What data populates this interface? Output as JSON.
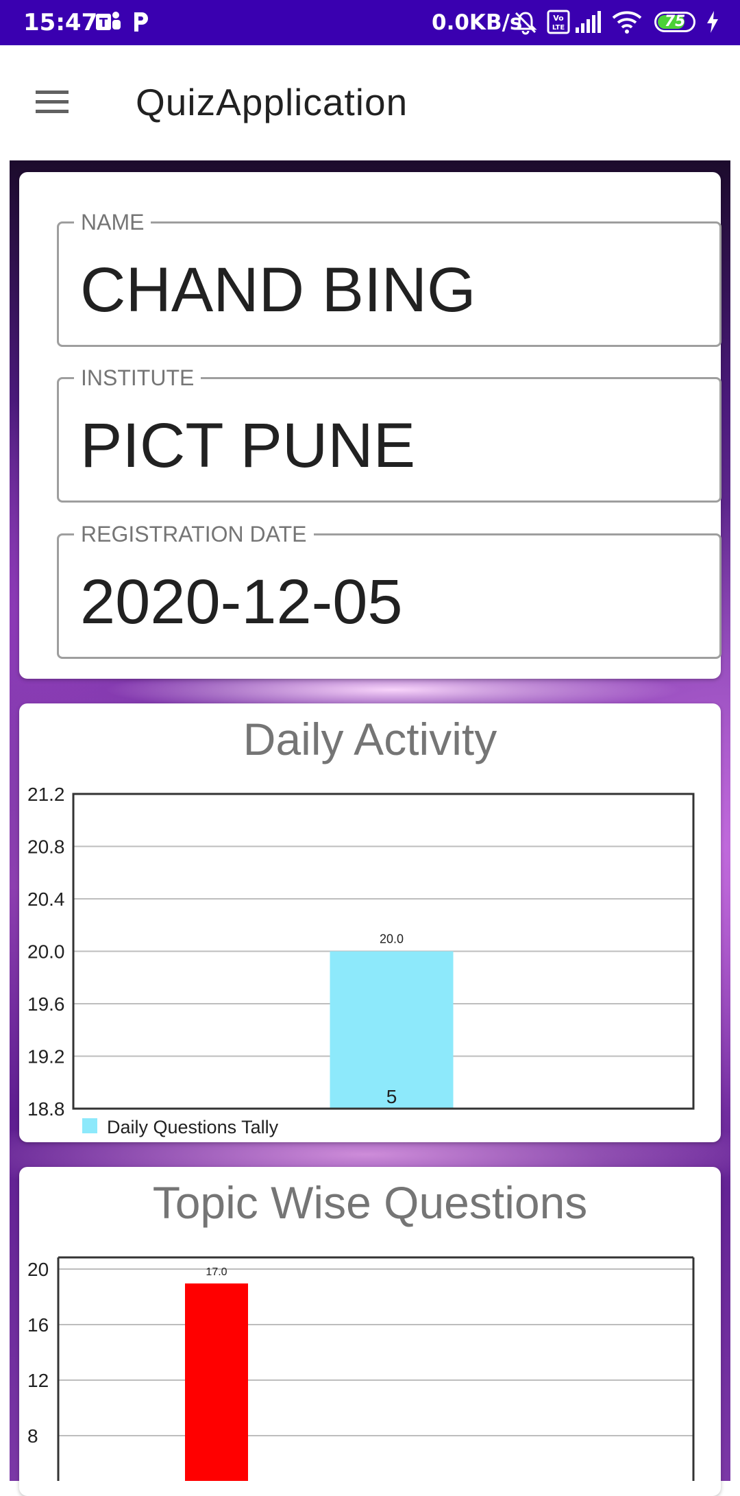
{
  "status_bar": {
    "time": "15:47",
    "network_speed": "0.0KB/s",
    "battery_level": "75",
    "icons": [
      "teams-icon",
      "p-app-icon",
      "mute-icon",
      "volte-icon",
      "signal-icon",
      "wifi-icon",
      "battery-icon",
      "charging-icon"
    ]
  },
  "app_bar": {
    "title": "QuizApplication",
    "menu_icon": "hamburger-menu-icon"
  },
  "profile": {
    "name_label": "NAME",
    "name_value": "CHAND BING",
    "institute_label": "INSTITUTE",
    "institute_value": "PICT PUNE",
    "date_label": "REGISTRATION DATE",
    "date_value": "2020-12-05"
  },
  "colors": {
    "status_bar": "#3a00b0",
    "daily_bar": "#8de9fb",
    "topic_bar": "#ff0000"
  },
  "chart_data": [
    {
      "type": "bar",
      "title": "Daily Activity",
      "categories": [
        "5"
      ],
      "series": [
        {
          "name": "Daily Questions Tally",
          "values": [
            20.0
          ],
          "value_labels": [
            "20.0"
          ]
        }
      ],
      "ylim": [
        18.8,
        21.2
      ],
      "yticks": [
        "18.8",
        "19.2",
        "19.6",
        "20.0",
        "20.4",
        "20.8",
        "21.2"
      ],
      "grid": true,
      "legend": "bottom-left"
    },
    {
      "type": "bar",
      "title": "Topic Wise Questions",
      "categories": [
        ""
      ],
      "series": [
        {
          "values": [
            17.0
          ],
          "value_labels": [
            "17.0"
          ]
        }
      ],
      "yticks": [
        "8",
        "12",
        "16",
        "20"
      ],
      "grid": true
    }
  ]
}
